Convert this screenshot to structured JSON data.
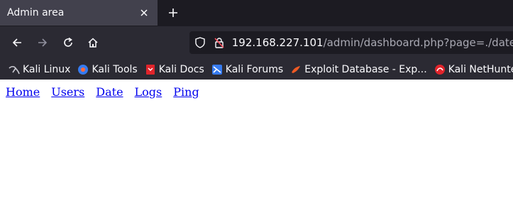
{
  "browser": {
    "tab": {
      "title": "Admin area"
    },
    "url": {
      "host": "192.168.227.101",
      "path": "/admin/dashboard.php?page=./date"
    },
    "bookmarks": [
      {
        "label": "Kali Linux",
        "icon": "kali-dragon-icon"
      },
      {
        "label": "Kali Tools",
        "icon": "kali-tools-icon"
      },
      {
        "label": "Kali Docs",
        "icon": "kali-docs-icon"
      },
      {
        "label": "Kali Forums",
        "icon": "kali-forums-icon"
      },
      {
        "label": "Exploit Database - Exp...",
        "icon": "exploit-db-icon"
      },
      {
        "label": "Kali NetHunter",
        "icon": "nethunter-icon"
      }
    ],
    "colors": {
      "chrome_dark": "#1c1b22",
      "toolbar": "#2b2a33",
      "active_tab": "#42414d",
      "link": "#0000ee"
    }
  },
  "page": {
    "nav_links": [
      "Home",
      "Users",
      "Date",
      "Logs",
      "Ping"
    ]
  }
}
